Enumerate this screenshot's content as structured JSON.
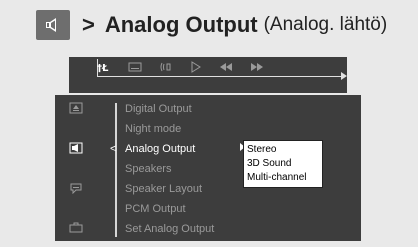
{
  "heading": {
    "arrow": ">",
    "title": "Analog Output",
    "subtitle": "(Analog. lähtö)"
  },
  "topbar": {
    "icons": [
      "settings-icon",
      "subtitle-icon",
      "audio-icon",
      "play-icon",
      "rewind-icon",
      "fast-forward-icon"
    ]
  },
  "sidebar": {
    "icons": [
      "general-setup-icon",
      "audio-setup-icon",
      "subtitle-setup-icon",
      "preference-icon"
    ],
    "selected": "audio-setup-icon"
  },
  "menu": {
    "items": [
      {
        "label": "Digital Output",
        "active": false
      },
      {
        "label": "Night mode",
        "active": false
      },
      {
        "label": "Analog Output",
        "active": true
      },
      {
        "label": "Speakers",
        "active": false
      },
      {
        "label": "Speaker Layout",
        "active": false
      },
      {
        "label": "PCM Output",
        "active": false
      },
      {
        "label": "Set  Analog  Output",
        "active": false
      }
    ],
    "pointer_left": "<",
    "submenu": [
      "Stereo",
      "3D Sound",
      "Multi-channel"
    ]
  },
  "colors": {
    "osd_background": "#3d3d3d",
    "active_text": "#ffffff",
    "inactive_text": "#9a9a9a",
    "page_background": "#e9e9e9"
  }
}
